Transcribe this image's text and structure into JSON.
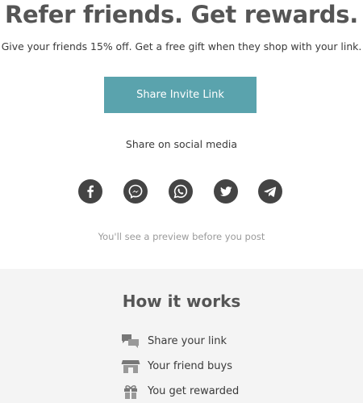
{
  "hero": {
    "headline": "Refer friends. Get rewards.",
    "subhead": "Give your friends 15% off. Get a free gift when they shop with your link."
  },
  "invite": {
    "button_label": "Share Invite Link",
    "button_color": "#5aa3ad"
  },
  "social": {
    "label": "Share on social media",
    "items": [
      {
        "icon": "facebook-icon"
      },
      {
        "icon": "messenger-icon"
      },
      {
        "icon": "whatsapp-icon"
      },
      {
        "icon": "twitter-icon"
      },
      {
        "icon": "telegram-icon"
      }
    ],
    "preview_note": "You'll see a preview before you post"
  },
  "how_it_works": {
    "title": "How it works",
    "steps": [
      {
        "icon": "chat-bubbles-icon",
        "label": "Share your link"
      },
      {
        "icon": "storefront-icon",
        "label": "Your friend buys"
      },
      {
        "icon": "gift-icon",
        "label": "You get rewarded"
      }
    ]
  }
}
